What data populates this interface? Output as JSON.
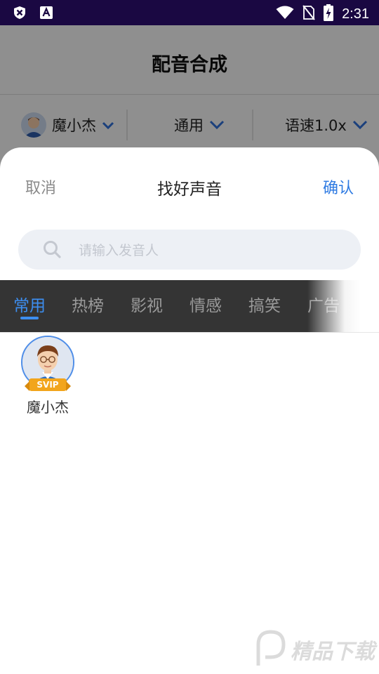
{
  "status_bar": {
    "time": "2:31",
    "left_icons": [
      "app-notification-icon",
      "text-a-icon"
    ],
    "right_icons": [
      "wifi-icon",
      "no-sim-icon",
      "battery-charging-icon"
    ]
  },
  "underlying_page": {
    "title": "配音合成",
    "bar": {
      "voice_label": "魔小杰",
      "category_label": "通用",
      "speed_label": "语速1.0x"
    }
  },
  "sheet": {
    "cancel_label": "取消",
    "title": "找好声音",
    "confirm_label": "确认",
    "search": {
      "placeholder": "请输入发音人",
      "value": ""
    },
    "tabs": [
      {
        "label": "常用",
        "active": true
      },
      {
        "label": "热榜",
        "active": false
      },
      {
        "label": "影视",
        "active": false
      },
      {
        "label": "情感",
        "active": false
      },
      {
        "label": "搞笑",
        "active": false
      },
      {
        "label": "广告",
        "active": false
      }
    ],
    "voices": [
      {
        "name": "魔小杰",
        "badge": "SVIP"
      }
    ]
  },
  "watermark": {
    "text": "精品下载"
  },
  "colors": {
    "accent": "#3d8ef0",
    "confirm": "#2f7be2",
    "status_bar": "#1a0842",
    "tab_bar": "#343434",
    "badge": "#f2a51c"
  }
}
